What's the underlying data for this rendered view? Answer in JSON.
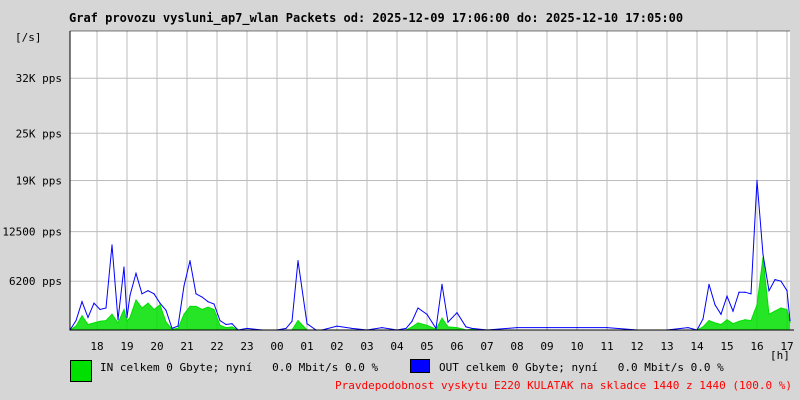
{
  "title": "Graf provozu vysluni_ap7_wlan Packets od: 2025-12-09 17:06:00 do: 2025-12-10 17:05:00",
  "unit_label": "[/s]",
  "x_unit_label": "[h]",
  "legend": {
    "in_label": "IN celkem 0 Gbyte; nyní   0.0 Mbit/s 0.0 %",
    "out_label": "OUT celkem 0 Gbyte; nyní   0.0 Mbit/s 0.0 %"
  },
  "note": "Pravdepodobnost vyskytu E220 KULATAK na skladce 1440 z 1440 (100.0 %)",
  "colors": {
    "in": "#00e000",
    "out": "#0000ff",
    "note": "#ff0000",
    "grid": "#bdbdbd",
    "background": "#ffffff"
  },
  "chart_data": {
    "type": "area",
    "y_ticks": [
      {
        "value": 6200,
        "label": "6200 pps"
      },
      {
        "value": 12500,
        "label": "12500 pps"
      },
      {
        "value": 19000,
        "label": "19K pps"
      },
      {
        "value": 25000,
        "label": "25K pps"
      },
      {
        "value": 32000,
        "label": "32K pps"
      }
    ],
    "ylim": [
      0,
      38000
    ],
    "xlim": [
      17.1,
      41.1
    ],
    "x_ticks": [
      {
        "value": 18,
        "label": "18"
      },
      {
        "value": 19,
        "label": "19"
      },
      {
        "value": 20,
        "label": "20"
      },
      {
        "value": 21,
        "label": "21"
      },
      {
        "value": 22,
        "label": "22"
      },
      {
        "value": 23,
        "label": "23"
      },
      {
        "value": 24,
        "label": "00"
      },
      {
        "value": 25,
        "label": "01"
      },
      {
        "value": 26,
        "label": "02"
      },
      {
        "value": 27,
        "label": "03"
      },
      {
        "value": 28,
        "label": "04"
      },
      {
        "value": 29,
        "label": "05"
      },
      {
        "value": 30,
        "label": "06"
      },
      {
        "value": 31,
        "label": "07"
      },
      {
        "value": 32,
        "label": "08"
      },
      {
        "value": 33,
        "label": "09"
      },
      {
        "value": 34,
        "label": "10"
      },
      {
        "value": 35,
        "label": "11"
      },
      {
        "value": 36,
        "label": "12"
      },
      {
        "value": 37,
        "label": "13"
      },
      {
        "value": 38,
        "label": "14"
      },
      {
        "value": 39,
        "label": "15"
      },
      {
        "value": 40,
        "label": "16"
      },
      {
        "value": 41,
        "label": "17"
      }
    ],
    "series": [
      {
        "name": "IN",
        "x": [
          17.1,
          17.3,
          17.5,
          17.7,
          17.9,
          18.1,
          18.3,
          18.5,
          18.7,
          18.9,
          19.0,
          19.1,
          19.3,
          19.5,
          19.7,
          19.9,
          20.1,
          20.3,
          20.5,
          20.7,
          20.9,
          21.1,
          21.3,
          21.5,
          21.7,
          21.9,
          22.1,
          22.3,
          22.5,
          22.7,
          23.0,
          23.5,
          24.0,
          24.3,
          24.5,
          24.7,
          25.0,
          25.3,
          25.5,
          26.0,
          26.5,
          27.0,
          27.5,
          28.0,
          28.3,
          28.5,
          28.7,
          29.0,
          29.3,
          29.5,
          29.7,
          30.0,
          30.3,
          30.5,
          31.0,
          32.0,
          33.0,
          34.0,
          35.0,
          36.0,
          37.0,
          37.7,
          38.0,
          38.2,
          38.4,
          38.6,
          38.8,
          39.0,
          39.2,
          39.4,
          39.6,
          39.8,
          40.0,
          40.2,
          40.4,
          40.6,
          40.8,
          41.0,
          41.1
        ],
        "values": [
          0,
          500,
          1800,
          700,
          900,
          1100,
          1200,
          2000,
          900,
          2600,
          1100,
          1600,
          3800,
          2800,
          3400,
          2600,
          3200,
          1000,
          100,
          200,
          2000,
          3000,
          3000,
          2600,
          2900,
          2600,
          600,
          300,
          400,
          0,
          0,
          0,
          0,
          0,
          0,
          1200,
          0,
          0,
          0,
          0,
          0,
          0,
          0,
          0,
          0,
          400,
          900,
          600,
          100,
          1500,
          400,
          300,
          0,
          100,
          0,
          0,
          0,
          0,
          0,
          0,
          0,
          0,
          0,
          400,
          1200,
          900,
          700,
          1300,
          800,
          1100,
          1300,
          1200,
          3200,
          9200,
          2000,
          2400,
          2800,
          2600,
          1000
        ]
      },
      {
        "name": "OUT",
        "x": [
          17.1,
          17.3,
          17.5,
          17.7,
          17.9,
          18.1,
          18.3,
          18.5,
          18.7,
          18.9,
          19.0,
          19.1,
          19.3,
          19.5,
          19.7,
          19.9,
          20.1,
          20.3,
          20.5,
          20.7,
          20.9,
          21.1,
          21.3,
          21.5,
          21.7,
          21.9,
          22.1,
          22.3,
          22.5,
          22.7,
          23.0,
          23.5,
          24.0,
          24.3,
          24.5,
          24.7,
          25.0,
          25.3,
          25.5,
          26.0,
          26.5,
          27.0,
          27.5,
          28.0,
          28.3,
          28.5,
          28.7,
          29.0,
          29.3,
          29.5,
          29.7,
          30.0,
          30.3,
          30.5,
          31.0,
          32.0,
          33.0,
          34.0,
          35.0,
          36.0,
          37.0,
          37.7,
          38.0,
          38.2,
          38.4,
          38.6,
          38.8,
          39.0,
          39.2,
          39.4,
          39.6,
          39.8,
          40.0,
          40.2,
          40.4,
          40.6,
          40.8,
          41.0,
          41.1
        ],
        "values": [
          0,
          1200,
          3600,
          1600,
          3400,
          2600,
          2800,
          10800,
          1300,
          8000,
          1600,
          4400,
          7200,
          4600,
          5000,
          4600,
          3400,
          2500,
          200,
          500,
          5600,
          8800,
          4600,
          4200,
          3600,
          3300,
          1200,
          700,
          800,
          0,
          200,
          0,
          0,
          200,
          1100,
          8800,
          800,
          0,
          0,
          500,
          200,
          0,
          300,
          0,
          200,
          1100,
          2800,
          2000,
          200,
          5800,
          1000,
          2200,
          400,
          200,
          0,
          300,
          300,
          300,
          300,
          0,
          0,
          300,
          0,
          1400,
          5800,
          3200,
          2000,
          4300,
          2400,
          4800,
          4800,
          4600,
          19000,
          9600,
          5000,
          6400,
          6200,
          5000,
          1200
        ]
      }
    ]
  }
}
